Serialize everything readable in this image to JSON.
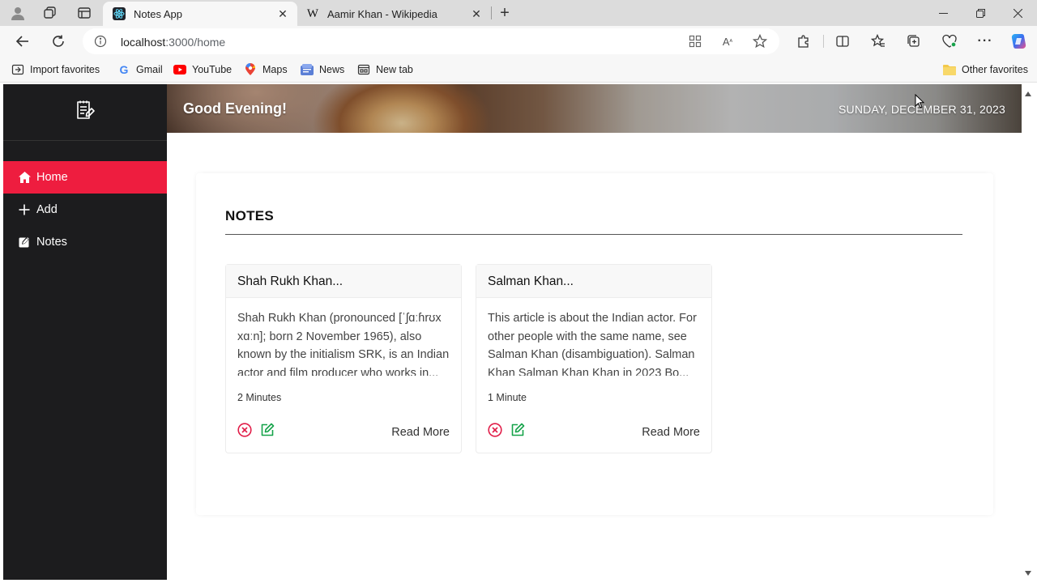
{
  "browser": {
    "tabs": [
      {
        "title": "Notes App",
        "active": true,
        "icon": "react-icon"
      },
      {
        "title": "Aamir Khan - Wikipedia",
        "active": false,
        "icon": "wikipedia-icon"
      }
    ],
    "address": {
      "host": "localhost",
      "path": ":3000/home"
    },
    "favorites": [
      {
        "label": "Import favorites",
        "icon": "import-icon"
      },
      {
        "label": "Gmail",
        "icon": "google-icon"
      },
      {
        "label": "YouTube",
        "icon": "youtube-icon"
      },
      {
        "label": "Maps",
        "icon": "maps-icon"
      },
      {
        "label": "News",
        "icon": "news-icon"
      },
      {
        "label": "New tab",
        "icon": "newtab-icon"
      }
    ],
    "other_favorites": "Other favorites"
  },
  "sidebar": {
    "logo_icon": "notepad-icon",
    "items": [
      {
        "label": "Home",
        "icon": "home-icon",
        "active": true
      },
      {
        "label": "Add",
        "icon": "plus-icon",
        "active": false
      },
      {
        "label": "Notes",
        "icon": "note-icon",
        "active": false
      }
    ]
  },
  "header": {
    "greeting": "Good Evening!",
    "date": "SUNDAY, DECEMBER 31, 2023"
  },
  "notes": {
    "heading": "NOTES",
    "cards": [
      {
        "title": "Shah Rukh Khan...",
        "excerpt": "Shah Rukh Khan (pronounced [ˈʃɑːɦrʊx xɑːn]; born 2 November 1965), also known by the initialism SRK, is an Indian actor and film producer who works in...",
        "read_time": "2 Minutes",
        "read_more": "Read More"
      },
      {
        "title": "Salman Khan...",
        "excerpt": "This article is about the Indian actor. For other people with the same name, see Salman Khan (disambiguation). Salman Khan Salman Khan Khan in 2023 Bo...",
        "read_time": "1 Minute",
        "read_more": "Read More"
      }
    ]
  },
  "colors": {
    "accent": "#ee1d3f",
    "sidebar_bg": "#1c1c1e",
    "delete": "#e11d48",
    "edit": "#16a34a"
  }
}
